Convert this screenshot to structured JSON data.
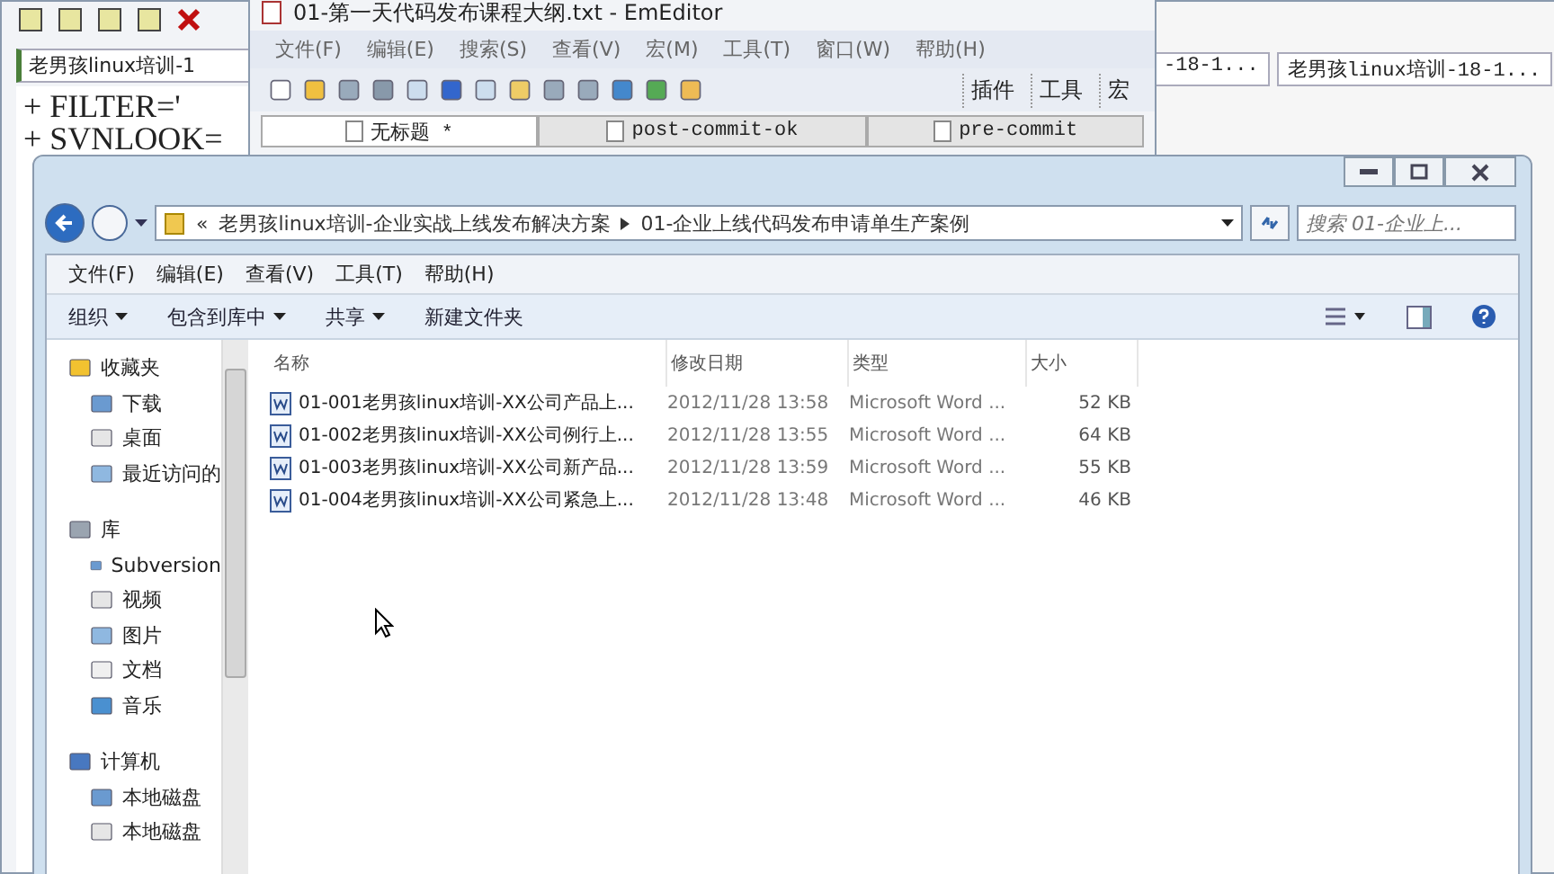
{
  "background_editor": {
    "tab": "老男孩linux培训-1",
    "lines": [
      "+ FILTER='",
      "+ SVNLOOK="
    ]
  },
  "emeditor": {
    "title": "01-第一天代码发布课程大纲.txt - EmEditor",
    "menu": [
      "文件(F)",
      "编辑(E)",
      "搜索(S)",
      "查看(V)",
      "宏(M)",
      "工具(T)",
      "窗口(W)",
      "帮助(H)"
    ],
    "toolbar_groups": [
      "插件",
      "工具",
      "宏"
    ],
    "tabs": [
      {
        "label": "无标题 *",
        "selected": true
      },
      {
        "label": "post-commit-ok",
        "selected": false
      },
      {
        "label": "pre-commit",
        "selected": false
      }
    ]
  },
  "background_window": {
    "tabs": [
      "-18-1...",
      "老男孩linux培训-18-1..."
    ]
  },
  "explorer": {
    "address": {
      "overflow": "«",
      "crumbs": [
        "老男孩linux培训-企业实战上线发布解决方案",
        "01-企业上线代码发布申请单生产案例"
      ]
    },
    "search": {
      "placeholder": "搜索 01-企业上..."
    },
    "menu": [
      "文件(F)",
      "编辑(E)",
      "查看(V)",
      "工具(T)",
      "帮助(H)"
    ],
    "commands": [
      {
        "label": "组织",
        "dropdown": true
      },
      {
        "label": "包含到库中",
        "dropdown": true
      },
      {
        "label": "共享",
        "dropdown": true
      },
      {
        "label": "新建文件夹",
        "dropdown": false
      }
    ],
    "sidebar": [
      {
        "label": "收藏夹",
        "children": [
          "下载",
          "桌面",
          "最近访问的"
        ]
      },
      {
        "label": "库",
        "children": [
          "Subversion",
          "视频",
          "图片",
          "文档",
          "音乐"
        ]
      },
      {
        "label": "计算机",
        "children": [
          "本地磁盘",
          "本地磁盘"
        ]
      }
    ],
    "columns": [
      "名称",
      "修改日期",
      "类型",
      "大小"
    ],
    "rows": [
      [
        "01-001老男孩linux培训-XX公司产品上...",
        "2012/11/28 13:58",
        "Microsoft Word ...",
        "52 KB"
      ],
      [
        "01-002老男孩linux培训-XX公司例行上...",
        "2012/11/28 13:55",
        "Microsoft Word ...",
        "64 KB"
      ],
      [
        "01-003老男孩linux培训-XX公司新产品...",
        "2012/11/28 13:59",
        "Microsoft Word ...",
        "55 KB"
      ],
      [
        "01-004老男孩linux培训-XX公司紧急上...",
        "2012/11/28 13:48",
        "Microsoft Word ...",
        "46 KB"
      ]
    ]
  }
}
